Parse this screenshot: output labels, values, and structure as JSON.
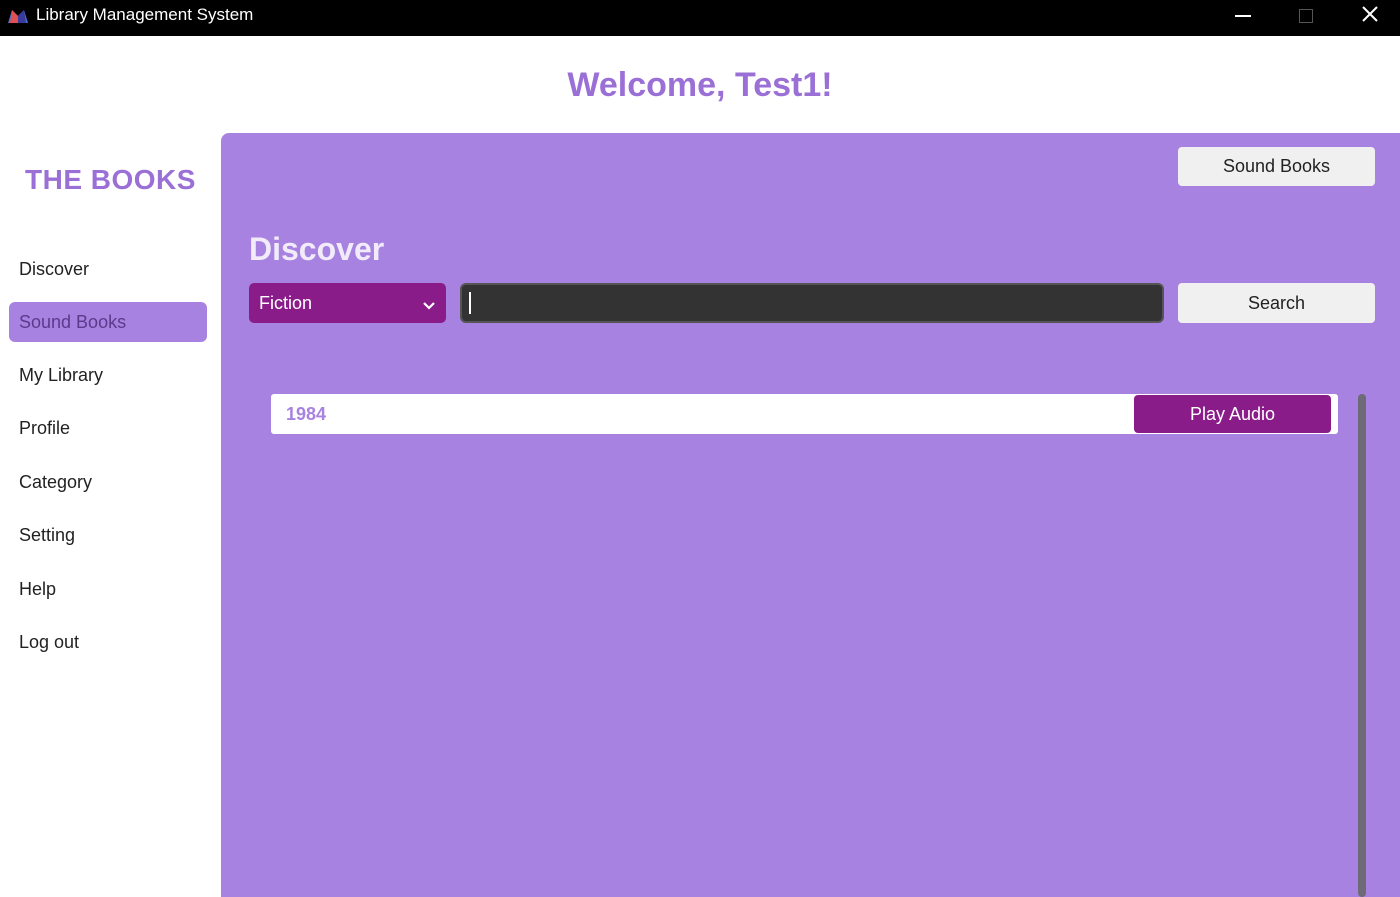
{
  "window": {
    "title": "Library Management System",
    "icon": "books-icon"
  },
  "header": {
    "welcome": "Welcome, Test1!"
  },
  "sidebar": {
    "brand": "THE BOOKS",
    "items": [
      {
        "label": "Discover",
        "active": false
      },
      {
        "label": "Sound Books",
        "active": true
      },
      {
        "label": "My Library",
        "active": false
      },
      {
        "label": "Profile",
        "active": false
      },
      {
        "label": "Category",
        "active": false
      },
      {
        "label": "Setting",
        "active": false
      },
      {
        "label": "Help",
        "active": false
      },
      {
        "label": "Log out",
        "active": false
      }
    ]
  },
  "main": {
    "top_button": "Sound Books",
    "section_title": "Discover",
    "category": {
      "selected": "Fiction"
    },
    "search": {
      "value": "",
      "button_label": "Search"
    },
    "results": [
      {
        "title": "1984",
        "action_label": "Play Audio"
      }
    ]
  },
  "colors": {
    "accent": "#a882e0",
    "brand_text": "#9a6fd6",
    "button_dark": "#8a1c8a",
    "titlebar": "#000000"
  }
}
